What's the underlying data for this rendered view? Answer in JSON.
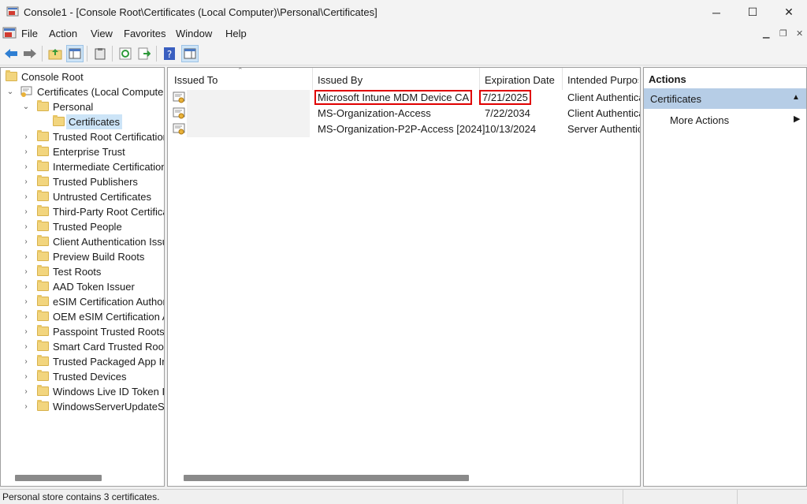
{
  "window": {
    "title": "Console1 - [Console Root\\Certificates (Local Computer)\\Personal\\Certificates]",
    "minimize_glyph": "─",
    "maximize_glyph": "☐",
    "close_glyph": "✕"
  },
  "menu": {
    "items": [
      "File",
      "Action",
      "View",
      "Favorites",
      "Window",
      "Help"
    ]
  },
  "tree": {
    "root": "Console Root",
    "store": "Certificates (Local Computer)",
    "personal": "Personal",
    "certificates": "Certificates",
    "folders": [
      "Trusted Root Certification",
      "Enterprise Trust",
      "Intermediate Certification",
      "Trusted Publishers",
      "Untrusted Certificates",
      "Third-Party Root Certificat",
      "Trusted People",
      "Client Authentication Issu",
      "Preview Build Roots",
      "Test Roots",
      "AAD Token Issuer",
      "eSIM Certification Author",
      "OEM eSIM Certification A",
      "Passpoint Trusted Roots",
      "Smart Card Trusted Roots",
      "Trusted Packaged App Ins",
      "Trusted Devices",
      "Windows Live ID Token Is",
      "WindowsServerUpdateSer"
    ]
  },
  "list": {
    "columns": [
      "Issued To",
      "Issued By",
      "Expiration Date",
      "Intended Purpos"
    ],
    "rows": [
      {
        "issued_to": "",
        "issued_by": "Microsoft Intune MDM Device CA",
        "expiration": "7/21/2025",
        "purpose": "Client Authentica"
      },
      {
        "issued_to": "",
        "issued_by": "MS-Organization-Access",
        "expiration": "7/22/2034",
        "purpose": "Client Authentica"
      },
      {
        "issued_to": "",
        "issued_by": "MS-Organization-P2P-Access [2024]",
        "expiration": "10/13/2024",
        "purpose": "Server Authentic"
      }
    ]
  },
  "actions": {
    "header": "Actions",
    "section": "Certificates",
    "more_actions": "More Actions"
  },
  "status": {
    "text": "Personal store contains 3 certificates."
  },
  "colors": {
    "highlight_box": "#e00000",
    "selection": "#cce4f7",
    "actions_section": "#b6cde6"
  }
}
